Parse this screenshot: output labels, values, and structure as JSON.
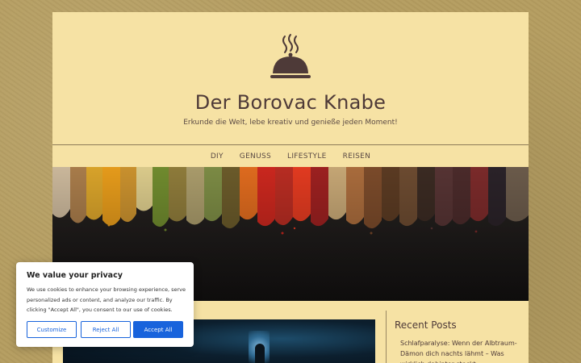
{
  "site": {
    "title": "Der Borovac Knabe",
    "tagline": "Erkunde die Welt, lebe kreativ und genieße jeden Moment!"
  },
  "nav": {
    "items": [
      {
        "label": "DIY"
      },
      {
        "label": "GENUSS"
      },
      {
        "label": "LIFESTYLE"
      },
      {
        "label": "REISEN"
      }
    ]
  },
  "sidebar": {
    "heading": "Recent Posts",
    "posts": [
      {
        "title": "Schlafparalyse: Wenn der Albtraum-Dämon dich nachts lähmt – Was wirklich dahinter steckt"
      }
    ]
  },
  "cookie": {
    "title": "We value your privacy",
    "text": "We use cookies to enhance your browsing experience, serve personalized ads or content, and analyze our traffic. By clicking \"Accept All\", you consent to our use of cookies.",
    "customize_label": "Customize",
    "reject_label": "Reject All",
    "accept_label": "Accept All"
  },
  "colors": {
    "page_bg": "#f6e2a4",
    "body_bg": "#b59d60",
    "title_text": "#4e3a38",
    "accent_blue": "#1863dc"
  },
  "icons": {
    "logo": "cloche-icon"
  }
}
